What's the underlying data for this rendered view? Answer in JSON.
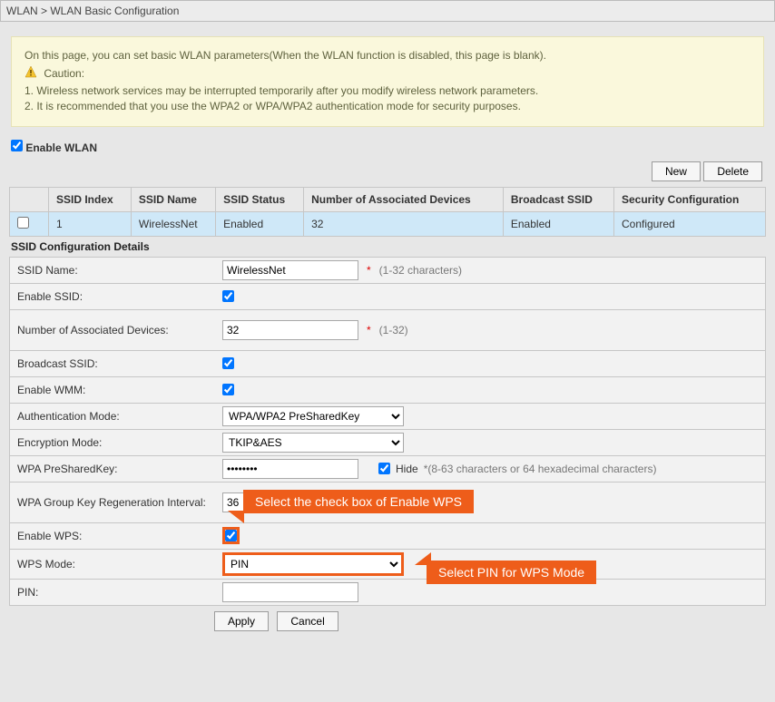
{
  "breadcrumb": "WLAN > WLAN Basic Configuration",
  "notice": {
    "intro": "On this page, you can set basic WLAN parameters(When the WLAN function is disabled, this page is blank).",
    "caution_label": "Caution:",
    "line1": "1. Wireless network services may be interrupted temporarily after you modify wireless network parameters.",
    "line2": "2. It is recommended that you use the WPA2 or WPA/WPA2 authentication mode for security purposes."
  },
  "enable_wlan_label": "Enable WLAN",
  "buttons": {
    "new": "New",
    "delete": "Delete",
    "apply": "Apply",
    "cancel": "Cancel"
  },
  "table": {
    "headers": {
      "idx": "SSID Index",
      "name": "SSID Name",
      "status": "SSID Status",
      "assoc": "Number of Associated Devices",
      "bcast": "Broadcast SSID",
      "sec": "Security Configuration"
    },
    "row": {
      "idx": "1",
      "name": "WirelessNet",
      "status": "Enabled",
      "assoc": "32",
      "bcast": "Enabled",
      "sec": "Configured"
    }
  },
  "section_title": "SSID Configuration Details",
  "form": {
    "ssid_name_label": "SSID Name:",
    "ssid_name_value": "WirelessNet",
    "ssid_name_hint": "(1-32 characters)",
    "enable_ssid_label": "Enable SSID:",
    "assoc_label": "Number of Associated Devices:",
    "assoc_value": "32",
    "assoc_hint": "(1-32)",
    "bcast_label": "Broadcast SSID:",
    "wmm_label": "Enable WMM:",
    "auth_label": "Authentication Mode:",
    "auth_value": "WPA/WPA2 PreSharedKey",
    "enc_label": "Encryption Mode:",
    "enc_value": "TKIP&AES",
    "psk_label": "WPA PreSharedKey:",
    "psk_value": "••••••••",
    "hide_label": "Hide",
    "psk_hint": "*(8-63 characters or 64 hexadecimal characters)",
    "regen_label": "WPA Group Key Regeneration Interval:",
    "regen_value": "36",
    "wps_label": "Enable WPS:",
    "wps_mode_label": "WPS Mode:",
    "wps_mode_value": "PIN",
    "pin_label": "PIN:",
    "pin_value": ""
  },
  "callouts": {
    "wps_check": "Select the check box of Enable WPS",
    "wps_mode": "Select PIN for WPS Mode"
  }
}
